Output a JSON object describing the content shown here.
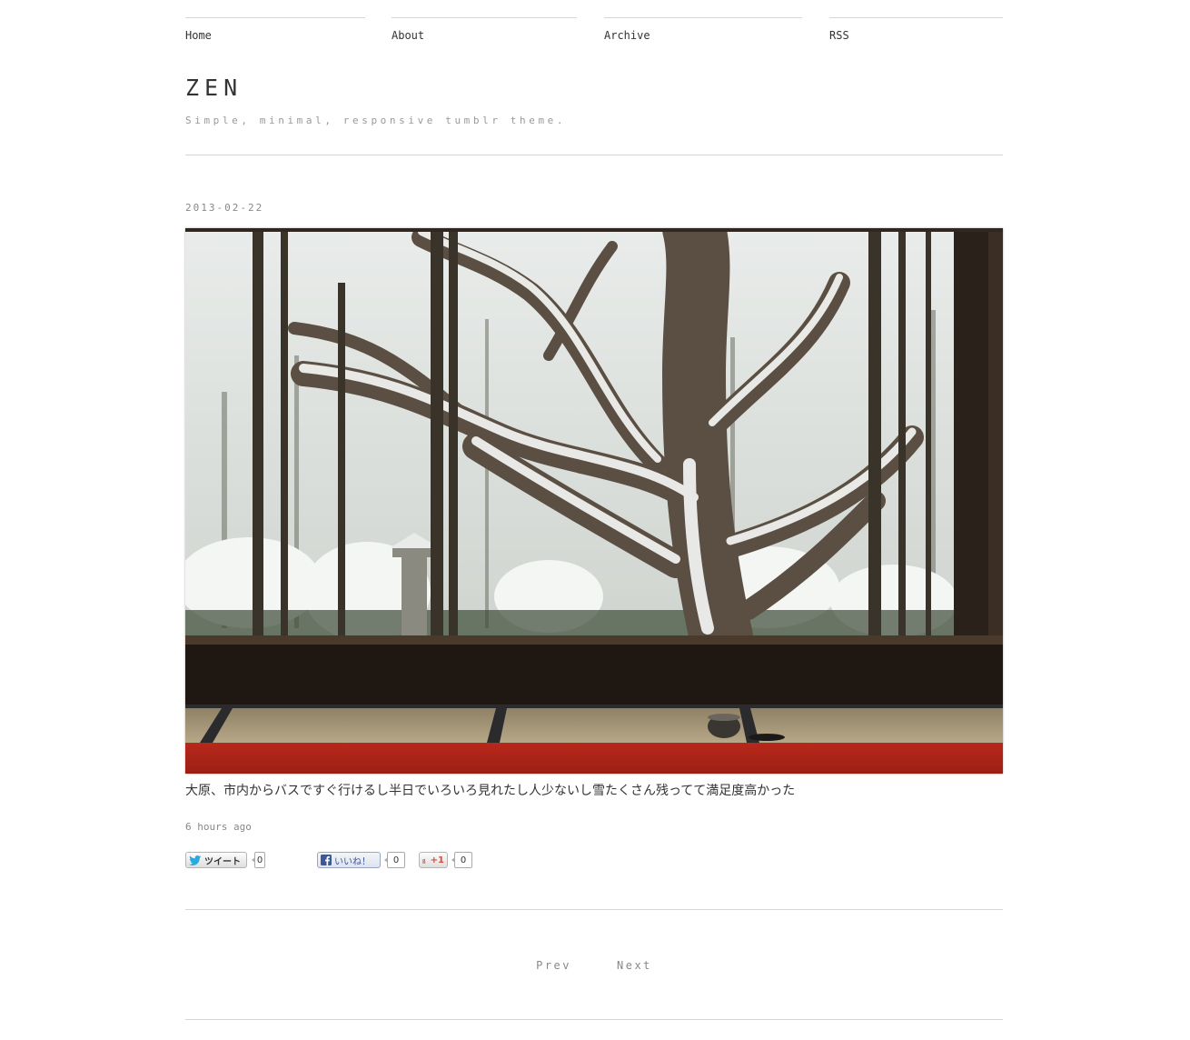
{
  "nav": {
    "items": [
      {
        "label": "Home"
      },
      {
        "label": "About"
      },
      {
        "label": "Archive"
      },
      {
        "label": "RSS"
      }
    ]
  },
  "site": {
    "title": "ZEN",
    "tagline": "Simple, minimal, responsive tumblr theme."
  },
  "post": {
    "date": "2013-02-22",
    "photo_subject": "snow-covered pine tree viewed from a tatami room with a tea bowl",
    "caption": "大原、市内からバスですぐ行けるし半日でいろいろ見れたし人少ないし雪たくさん残ってて満足度高かった",
    "time_ago": "6 hours ago"
  },
  "share": {
    "tweet": {
      "label": "ツイート",
      "count": "0",
      "icon": "twitter-bird-icon"
    },
    "like": {
      "label": "いいね！",
      "count": "0",
      "icon": "facebook-icon"
    },
    "plusone": {
      "label": "+1",
      "count": "0",
      "icon": "google-plus-icon"
    }
  },
  "pager": {
    "prev": "Prev",
    "next": "Next"
  },
  "colors": {
    "text": "#333333",
    "muted": "#888888",
    "rule": "#d6d6d6",
    "carpet": "#b02418",
    "facebook": "#3b5998",
    "twitter": "#2aa9e0",
    "google": "#dd4b39"
  }
}
